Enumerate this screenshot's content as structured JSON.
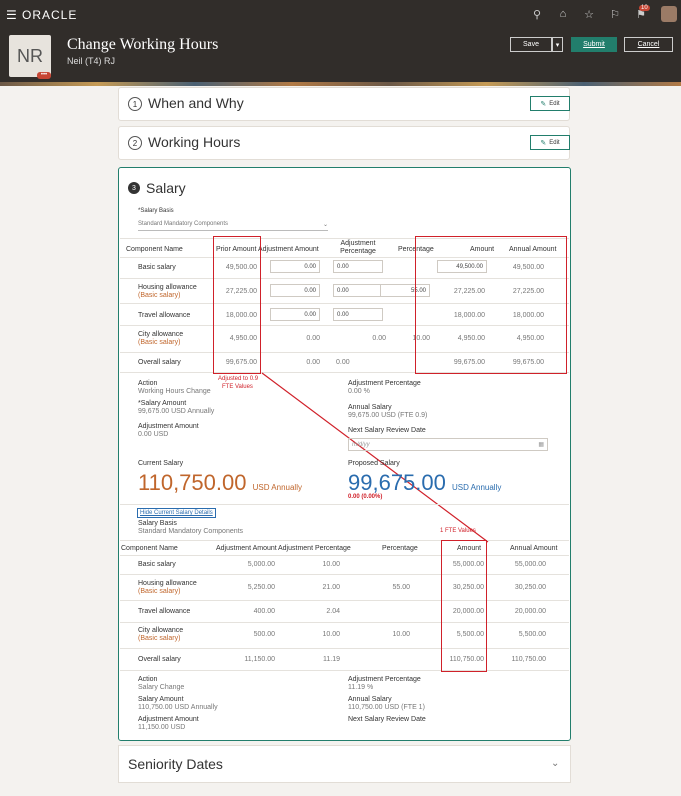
{
  "app": {
    "logo": "ORACLE"
  },
  "header": {
    "initials": "NR",
    "badge": "•••",
    "title": "Change Working Hours",
    "subtitle": "Neil (T4) RJ",
    "notif_count": "10",
    "buttons": {
      "save": "Save",
      "submit": "Submit",
      "cancel": "Cancel"
    }
  },
  "steps": [
    {
      "num": "1",
      "title": "When and Why",
      "edit": "Edit"
    },
    {
      "num": "2",
      "title": "Working Hours",
      "edit": "Edit"
    }
  ],
  "salary": {
    "num": "3",
    "title": "Salary",
    "basis_label": "*Salary Basis",
    "basis_value": "Standard Mandatory Components",
    "columns": [
      "Component Name",
      "Prior Amount",
      "Adjustment Amount",
      "Adjustment Percentage",
      "Percentage",
      "Amount",
      "Annual Amount"
    ],
    "rows": [
      {
        "name": "Basic salary",
        "sub": "",
        "prior": "49,500.00",
        "adj": "0.00",
        "adjpct": "0.00",
        "pct": "",
        "amount": "49,500.00",
        "annual": "49,500.00"
      },
      {
        "name": "Housing allowance",
        "sub": "(Basic salary)",
        "prior": "27,225.00",
        "adj": "0.00",
        "adjpct": "0.00",
        "pct": "55.00",
        "amount": "27,225.00",
        "annual": "27,225.00"
      },
      {
        "name": "Travel allowance",
        "sub": "",
        "prior": "18,000.00",
        "adj": "0.00",
        "adjpct": "0.00",
        "pct": "",
        "amount": "18,000.00",
        "annual": "18,000.00"
      },
      {
        "name": "City allowance",
        "sub": "(Basic salary)",
        "prior": "4,950.00",
        "adj": "0.00",
        "adjpct": "0.00",
        "pct": "10.00",
        "amount": "4,950.00",
        "annual": "4,950.00"
      },
      {
        "name": "Overall salary",
        "sub": "",
        "prior": "99,675.00",
        "adj": "0.00",
        "adjpct": "0.00",
        "pct": "",
        "amount": "99,675.00",
        "annual": "99,675.00"
      }
    ],
    "action_label": "Action",
    "action_value": "Working Hours Change",
    "sal_amount_label": "*Salary Amount",
    "sal_amount_value": "99,675.00 USD Annually",
    "adj_amount_label": "Adjustment Amount",
    "adj_amount_value": "0.00 USD",
    "adj_pct_label": "Adjustment Percentage",
    "adj_pct_value": "0.00 %",
    "annual_label": "Annual Salary",
    "annual_value": "99,675.00 USD (FTE 0.9)",
    "review_label": "Next Salary Review Date",
    "review_placeholder": "m/d/yy",
    "current_label": "Current Salary",
    "current_value": "110,750.00",
    "current_unit": "USD Annually",
    "proposed_label": "Proposed Salary",
    "proposed_value": "99,675.00",
    "proposed_unit": "USD Annually",
    "proposed_change": "0.00 (0.00%)",
    "annot_adjusted": "Adjusted to 0.9",
    "annot_adjusted2": "FTE Values",
    "annot_fte": "1 FTE Values",
    "hide_link": "Hide Current Salary Details",
    "cur_basis_label": "Salary Basis",
    "cur_basis_value": "Standard Mandatory Components",
    "cur_columns": [
      "Component Name",
      "Adjustment Amount",
      "Adjustment Percentage",
      "Percentage",
      "Amount",
      "Annual Amount"
    ],
    "cur_rows": [
      {
        "name": "Basic salary",
        "sub": "",
        "adj": "5,000.00",
        "adjpct": "10.00",
        "pct": "",
        "amount": "55,000.00",
        "annual": "55,000.00"
      },
      {
        "name": "Housing allowance",
        "sub": "(Basic salary)",
        "adj": "5,250.00",
        "adjpct": "21.00",
        "pct": "55.00",
        "amount": "30,250.00",
        "annual": "30,250.00"
      },
      {
        "name": "Travel allowance",
        "sub": "",
        "adj": "400.00",
        "adjpct": "2.04",
        "pct": "",
        "amount": "20,000.00",
        "annual": "20,000.00"
      },
      {
        "name": "City allowance",
        "sub": "(Basic salary)",
        "adj": "500.00",
        "adjpct": "10.00",
        "pct": "10.00",
        "amount": "5,500.00",
        "annual": "5,500.00"
      },
      {
        "name": "Overall salary",
        "sub": "",
        "adj": "11,150.00",
        "adjpct": "11.19",
        "pct": "",
        "amount": "110,750.00",
        "annual": "110,750.00"
      }
    ],
    "cur_action_label": "Action",
    "cur_action_value": "Salary Change",
    "cur_sal_label": "Salary Amount",
    "cur_sal_value": "110,750.00 USD Annually",
    "cur_adj_label": "Adjustment Amount",
    "cur_adj_value": "11,150.00 USD",
    "cur_adjpct_label": "Adjustment Percentage",
    "cur_adjpct_value": "11.19 %",
    "cur_annual_label": "Annual Salary",
    "cur_annual_value": "110,750.00 USD (FTE 1)",
    "cur_review_label": "Next Salary Review Date"
  },
  "seniority": {
    "title": "Seniority Dates"
  }
}
